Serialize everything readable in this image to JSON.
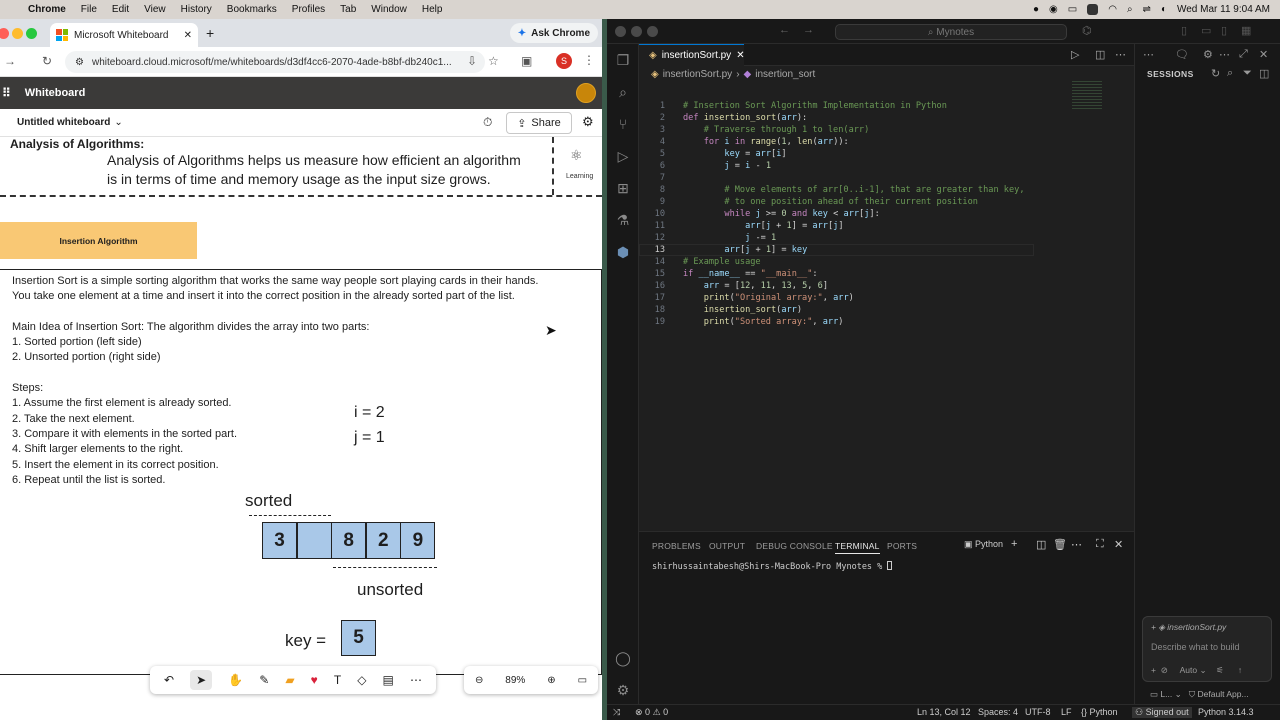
{
  "menubar": {
    "app": "Chrome",
    "items": [
      "File",
      "Edit",
      "View",
      "History",
      "Bookmarks",
      "Profiles",
      "Tab",
      "Window",
      "Help"
    ],
    "datetime": "Wed Mar 11  9:04 AM"
  },
  "browser": {
    "tab_title": "Microsoft Whiteboard",
    "ask_chrome": "Ask Chrome",
    "url": "whiteboard.cloud.microsoft/me/whiteboards/d3df4cc6-2070-4ade-b8bf-db240c1...",
    "profile_initial": "S"
  },
  "whiteboard": {
    "app_name": "Whiteboard",
    "doc_title": "Untitled whiteboard",
    "share_label": "Share",
    "learning_label": "Learning",
    "analysis_title": "Analysis of Algorithms:",
    "analysis_text_1": "Analysis of Algorithms helps us measure how efficient an algorithm",
    "analysis_text_2": "is in terms of time and memory usage as the input size grows.",
    "insertion_heading": "Insertion Algorithm",
    "body_lines": [
      "Insertion Sort is a simple sorting algorithm that works the same way people sort playing cards in their hands.",
      "You take one element at a time and insert it into the correct position in the already sorted part of the list.",
      "",
      "Main Idea of Insertion Sort: The algorithm divides the array into two parts:",
      "1. Sorted portion (left side)",
      "2. Unsorted portion (right side)",
      "",
      "Steps:",
      "1. Assume the first element is already sorted.",
      "2. Take the next element.",
      "3. Compare it with elements in the sorted part.",
      "4. Shift larger elements to the right.",
      "5. Insert the element in its correct position.",
      "6. Repeat until the list is sorted."
    ],
    "i_label": "i = 2",
    "j_label": "j = 1",
    "sorted_label": "sorted",
    "unsorted_label": "unsorted",
    "array_cells": [
      "3",
      "",
      "8",
      "2",
      "9"
    ],
    "key_label": "key =",
    "key_value": "5",
    "zoom": "89%"
  },
  "vscode": {
    "search_placeholder": "Mynotes",
    "file_tab": "insertionSort.py",
    "breadcrumb_file": "insertionSort.py",
    "breadcrumb_symbol": "insertion_sort",
    "sessions_label": "SESSIONS",
    "panel_tabs": [
      "PROBLEMS",
      "OUTPUT",
      "DEBUG CONSOLE",
      "TERMINAL",
      "PORTS"
    ],
    "terminal_kind": "Python",
    "terminal_prompt": "shirhussaintabesh@Shirs-MacBook-Pro Mynotes % ",
    "chat_file": "insertionSort.py",
    "chat_placeholder": "Describe what to build",
    "chat_mode": "Auto",
    "chat_agent": "L...",
    "chat_app": "Default App...",
    "status": {
      "errors": "0",
      "warnings": "0",
      "position": "Ln 13, Col 12",
      "spaces": "Spaces: 4",
      "encoding": "UTF-8",
      "eol": "LF",
      "language": "Python",
      "signed": "Signed out",
      "interpreter": "Python 3.14.3"
    },
    "code_lines": [
      "# Insertion Sort Algorithm Implementation in Python",
      "def insertion_sort(arr):",
      "    # Traverse through 1 to len(arr)",
      "    for i in range(1, len(arr)):",
      "        key = arr[i]",
      "        j = i - 1",
      "",
      "        # Move elements of arr[0..i-1], that are greater than key,",
      "        # to one position ahead of their current position",
      "        while j >= 0 and key < arr[j]:",
      "            arr[j + 1] = arr[j]",
      "            j -= 1",
      "        arr[j + 1] = key",
      "# Example usage",
      "if __name__ == \"__main__\":",
      "    arr = [12, 11, 13, 5, 6]",
      "    print(\"Original array:\", arr)",
      "    insertion_sort(arr)",
      "    print(\"Sorted array:\", arr)"
    ]
  }
}
